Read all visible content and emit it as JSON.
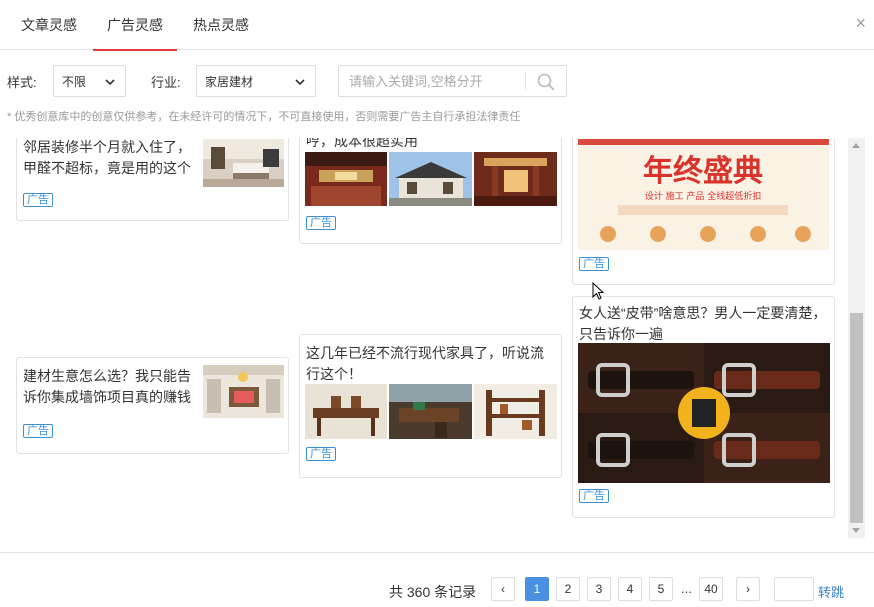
{
  "tabs": [
    {
      "label": "文章灵感"
    },
    {
      "label": "广告灵感",
      "active": true
    },
    {
      "label": "热点灵感"
    }
  ],
  "close_label": "×",
  "filters": {
    "style_label": "样式:",
    "style_value": "不限",
    "industry_label": "行业:",
    "industry_value": "家居建材",
    "search_placeholder": "请输入关键词,空格分开"
  },
  "notice": "* 优秀创意库中的创意仅供参考，在未经许可的情况下，不可直接使用，否则需要广告主自行承担法律责任",
  "cards": {
    "c1": {
      "title": "邻居装修半个月就入住了，甲醛不超标，竟是用的这个",
      "badge": "广告"
    },
    "c2": {
      "title": "哼，成本很超实用",
      "badge": "广告"
    },
    "c3": {
      "badge": "广告",
      "banner_text": "年终盛典",
      "banner_sub": "设计 施工 产品 全线超低折扣"
    },
    "c4": {
      "title": "建材生意怎么选？我只能告诉你集成墙饰项目真的赚钱",
      "badge": "广告"
    },
    "c5": {
      "title": "这几年已经不流行现代家具了，听说流行这个！",
      "badge": "广告"
    },
    "c6": {
      "title": "女人送“皮带”啥意思？男人一定要清楚，只告诉你一遍",
      "badge": "广告"
    }
  },
  "pagination": {
    "total_text": "共 360 条记录",
    "prev": "‹",
    "pages": [
      "1",
      "2",
      "3",
      "4",
      "5"
    ],
    "ellipsis": "...",
    "last": "40",
    "next": "›",
    "goto_label": "转跳",
    "current": 1
  },
  "colors": {
    "accent": "#e4393c",
    "link": "#3a8fd6",
    "page_active": "#4a90e2"
  }
}
